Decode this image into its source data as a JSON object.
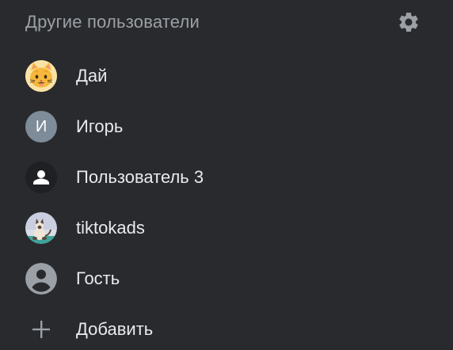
{
  "header": {
    "title": "Другие пользователи",
    "settings_icon": "gear-icon"
  },
  "profiles": [
    {
      "label": "Дай",
      "avatar": "cat-face-icon"
    },
    {
      "label": "Игорь",
      "avatar_letter": "И",
      "avatar_color": "#7d8c98"
    },
    {
      "label": "Пользователь 3",
      "avatar": "person-icon"
    },
    {
      "label": "tiktokads",
      "avatar": "siamese-cat-photo"
    },
    {
      "label": "Гость",
      "avatar": "guest-person-icon"
    }
  ],
  "add": {
    "label": "Добавить",
    "icon": "plus-icon"
  },
  "colors": {
    "background": "#292a2d",
    "title_text": "#9aa0a6",
    "item_text": "#e8eaed",
    "icon_gray": "#9aa0a6"
  }
}
